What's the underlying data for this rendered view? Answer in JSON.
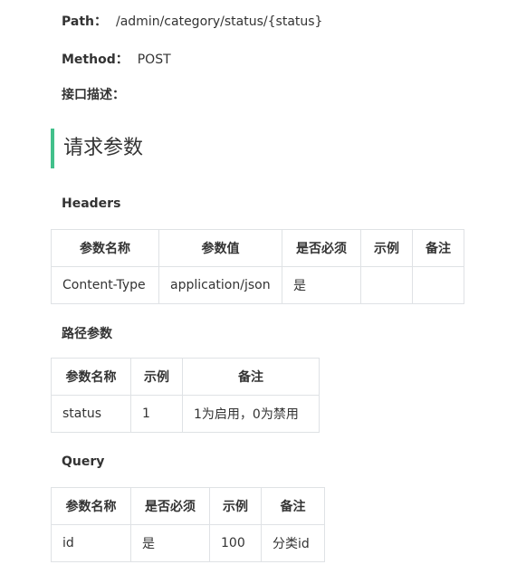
{
  "meta": {
    "path_label": "Path：",
    "path_value": "/admin/category/status/{status}",
    "method_label": "Method：",
    "method_value": "POST",
    "desc_label": "接口描述："
  },
  "section_title": "请求参数",
  "headers": {
    "title": "Headers",
    "columns": [
      "参数名称",
      "参数值",
      "是否必须",
      "示例",
      "备注"
    ],
    "rows": [
      [
        "Content-Type",
        "application/json",
        "是",
        "",
        ""
      ]
    ]
  },
  "path_params": {
    "title": "路径参数",
    "columns": [
      "参数名称",
      "示例",
      "备注"
    ],
    "rows": [
      [
        "status",
        "1",
        "1为启用，0为禁用"
      ]
    ]
  },
  "query": {
    "title": "Query",
    "columns": [
      "参数名称",
      "是否必须",
      "示例",
      "备注"
    ],
    "rows": [
      [
        "id",
        "是",
        "100",
        "分类id"
      ]
    ]
  },
  "colors": {
    "accent": "#42c08b",
    "border": "#dfe2e5",
    "text": "#333333"
  }
}
